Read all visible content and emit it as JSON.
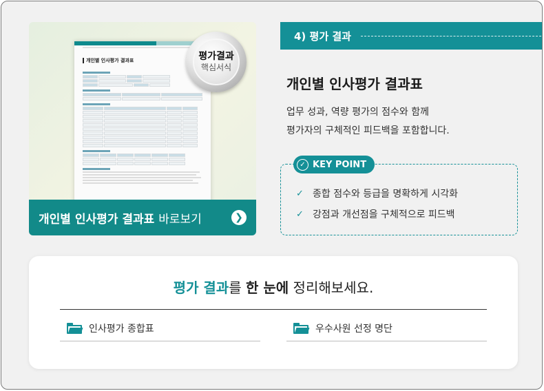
{
  "thumbnail": {
    "doc_title": "개인별 인사평가 결과표",
    "seal_line1": "평가결과",
    "seal_line2": "핵심서식",
    "cta_bold": "개인별 인사평가 결과표",
    "cta_rest": "바로보기",
    "cta_icon": "chevron-right-icon"
  },
  "step": {
    "label": "4) 평가 결과"
  },
  "info": {
    "title": "개인별 인사평가 결과표",
    "desc_line1": "업무 성과, 역량 평가의 점수와 함께",
    "desc_line2": "평가자의 구체적인 피드백을 포함합니다."
  },
  "key_point": {
    "badge": "KEY POINT",
    "items": [
      "종합 점수와 등급을 명확하게 시각화",
      "강점과 개선점을 구체적으로 피드백"
    ]
  },
  "bottom": {
    "tag_accent": "평가 결과",
    "tag_part2": "를 ",
    "tag_bold": "한 눈에",
    "tag_part3": " 정리해보세요.",
    "links": [
      "인사평가 종합표",
      "우수사원 선정 명단"
    ]
  },
  "colors": {
    "accent": "#149097",
    "cta_bar": "#128a89"
  }
}
